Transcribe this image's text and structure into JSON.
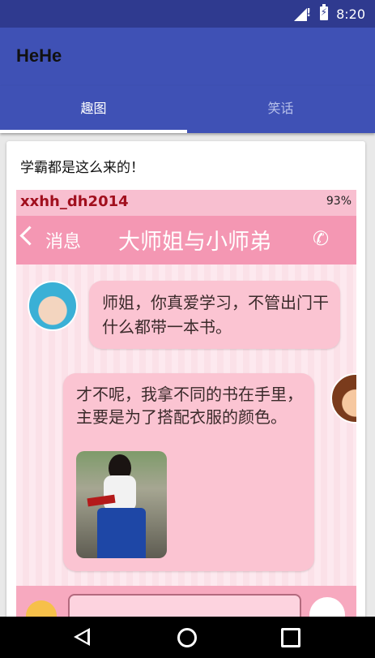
{
  "status_bar": {
    "time": "8:20"
  },
  "app_bar": {
    "title": "HeHe"
  },
  "tabs": [
    {
      "label": "趣图",
      "selected": true
    },
    {
      "label": "笑话",
      "selected": false
    }
  ],
  "card": {
    "caption": "学霸都是这么来的！",
    "image": {
      "username": "xxhh_dh2014",
      "battery": "93%",
      "back_label": "消息",
      "chat_title": "大师姐与小师弟",
      "messages": [
        {
          "text": "师姐，你真爱学习，不管出门干什么都带一本书。"
        },
        {
          "text": "才不呢，我拿不同的书在手里，主要是为了搭配衣服的颜色。"
        }
      ]
    }
  },
  "colors": {
    "status_bar": "#2f3a8f",
    "primary": "#3f51b5",
    "bubble": "#fbc4d2",
    "chat_header": "#f497b3"
  }
}
